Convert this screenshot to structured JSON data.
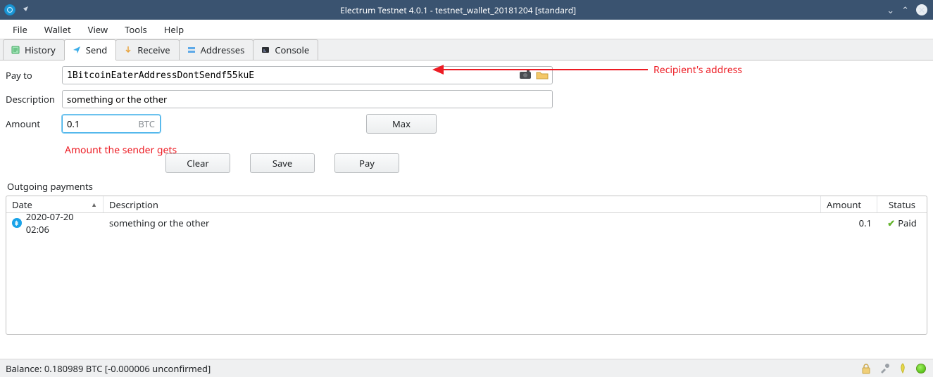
{
  "window": {
    "title": "Electrum Testnet 4.0.1 - testnet_wallet_20181204 [standard]"
  },
  "menu": {
    "file": "File",
    "wallet": "Wallet",
    "view": "View",
    "tools": "Tools",
    "help": "Help"
  },
  "tabs": {
    "history": "History",
    "send": "Send",
    "receive": "Receive",
    "addresses": "Addresses",
    "console": "Console"
  },
  "form": {
    "payto_label": "Pay to",
    "payto_value": "1BitcoinEaterAddressDontSendf55kuE",
    "desc_label": "Description",
    "desc_value": "something or the other",
    "amount_label": "Amount",
    "amount_value": "0.1",
    "amount_unit": "BTC",
    "max_btn": "Max",
    "clear_btn": "Clear",
    "save_btn": "Save",
    "pay_btn": "Pay"
  },
  "annotations": {
    "recipient": "Recipient's address",
    "amount_note": "Amount the sender gets"
  },
  "outgoing": {
    "heading": "Outgoing payments",
    "cols": {
      "date": "Date",
      "desc": "Description",
      "amount": "Amount",
      "status": "Status"
    },
    "rows": [
      {
        "date": "2020-07-20 02:06",
        "desc": "something or the other",
        "amount": "0.1",
        "status": "Paid"
      }
    ]
  },
  "statusbar": {
    "balance": "Balance: 0.180989 BTC  [-0.000006 unconfirmed]"
  }
}
